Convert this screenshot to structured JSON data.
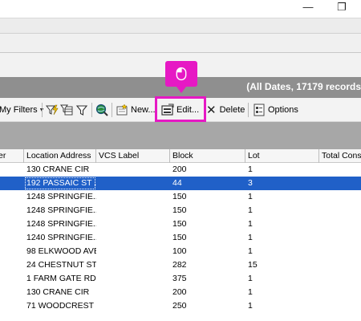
{
  "window": {
    "minimize_glyph": "—",
    "restore_glyph": "❐"
  },
  "summary": {
    "text": "(All Dates, 17179 records)"
  },
  "toolbar": {
    "my_filters_label": "My Filters",
    "new_label": "New...",
    "edit_label": "Edit...",
    "delete_label": "Delete",
    "options_label": "Options"
  },
  "callout": {
    "icon": "mouse-icon",
    "color": "#e619c4"
  },
  "grid": {
    "columns": [
      "er",
      "Location Address",
      "VCS Label",
      "Block",
      "Lot",
      "Total Cons"
    ],
    "rows": [
      {
        "address": "130 CRANE CIR",
        "vcs": "",
        "block": "200",
        "lot": "1",
        "selected": false
      },
      {
        "address": "192 PASSAIC ST . .",
        "vcs": "",
        "block": "44",
        "lot": "3",
        "selected": true
      },
      {
        "address": "1248 SPRINGFIE...",
        "vcs": "",
        "block": "150",
        "lot": "1",
        "selected": false
      },
      {
        "address": "1248 SPRINGFIE...",
        "vcs": "",
        "block": "150",
        "lot": "1",
        "selected": false
      },
      {
        "address": "1248 SPRINGFIE...",
        "vcs": "",
        "block": "150",
        "lot": "1",
        "selected": false
      },
      {
        "address": "1240 SPRINGFIE...",
        "vcs": "",
        "block": "150",
        "lot": "1",
        "selected": false
      },
      {
        "address": "98 ELKWOOD AVE",
        "vcs": "",
        "block": "100",
        "lot": "1",
        "selected": false
      },
      {
        "address": "24 CHESTNUT ST. .",
        "vcs": "",
        "block": "282",
        "lot": "15",
        "selected": false
      },
      {
        "address": "1 FARM GATE RD",
        "vcs": "",
        "block": "375",
        "lot": "1",
        "selected": false
      },
      {
        "address": "130 CRANE CIR",
        "vcs": "",
        "block": "200",
        "lot": "1",
        "selected": false
      },
      {
        "address": "71 WOODCREST ...",
        "vcs": "",
        "block": "250",
        "lot": "1",
        "selected": false
      }
    ]
  },
  "colors": {
    "header_bar": "#8f8f8f",
    "selection": "#2060c8",
    "highlight": "#e619c4"
  }
}
